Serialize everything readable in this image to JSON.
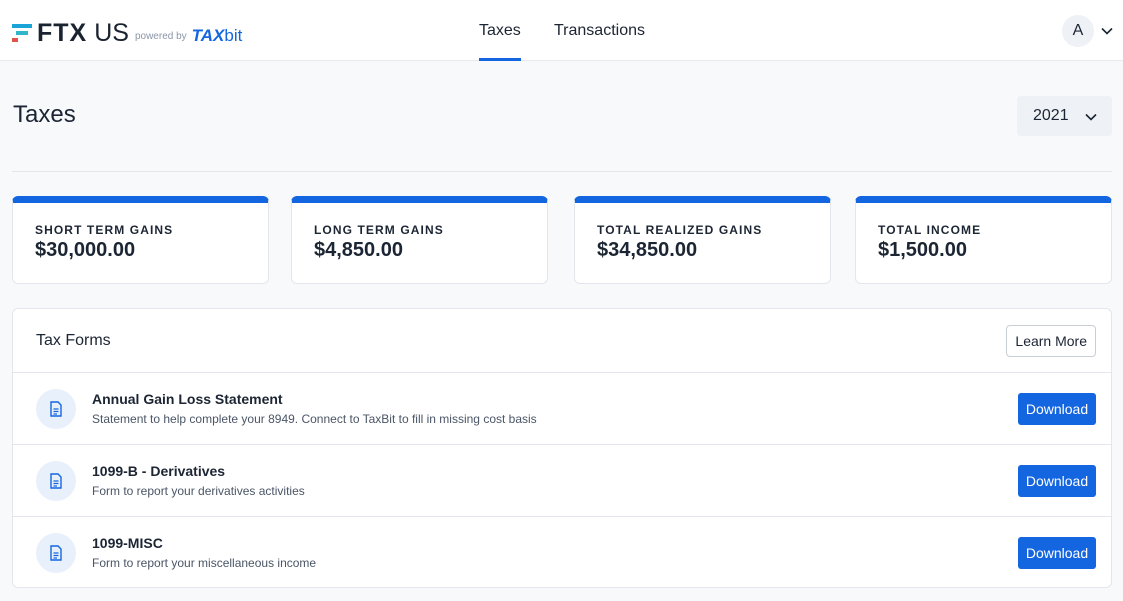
{
  "brand": {
    "name": "FTX",
    "suffix": "US",
    "powered_by": "powered by",
    "partner_bold": "TAX",
    "partner_rest": "bit",
    "accent_color": "#1466e0",
    "mark_colors": [
      "#1aa4d8",
      "#2fb6c8",
      "#e0524a"
    ]
  },
  "nav": {
    "tabs": [
      {
        "label": "Taxes",
        "active": true
      },
      {
        "label": "Transactions",
        "active": false
      }
    ],
    "avatar_initial": "A"
  },
  "page": {
    "title": "Taxes",
    "year": "2021"
  },
  "stats": [
    {
      "label": "SHORT TERM GAINS",
      "value": "$30,000.00"
    },
    {
      "label": "LONG TERM GAINS",
      "value": "$4,850.00"
    },
    {
      "label": "TOTAL REALIZED GAINS",
      "value": "$34,850.00"
    },
    {
      "label": "TOTAL INCOME",
      "value": "$1,500.00"
    }
  ],
  "tax_forms": {
    "title": "Tax Forms",
    "learn_more_label": "Learn More",
    "items": [
      {
        "name": "Annual Gain Loss Statement",
        "description": "Statement to help complete your 8949. Connect to TaxBit to fill in missing cost basis",
        "button_label": "Download",
        "icon": "document-icon"
      },
      {
        "name": "1099-B - Derivatives",
        "description": "Form to report your derivatives activities",
        "button_label": "Download",
        "icon": "document-icon"
      },
      {
        "name": "1099-MISC",
        "description": "Form to report your miscellaneous income",
        "button_label": "Download",
        "icon": "document-icon"
      }
    ]
  }
}
